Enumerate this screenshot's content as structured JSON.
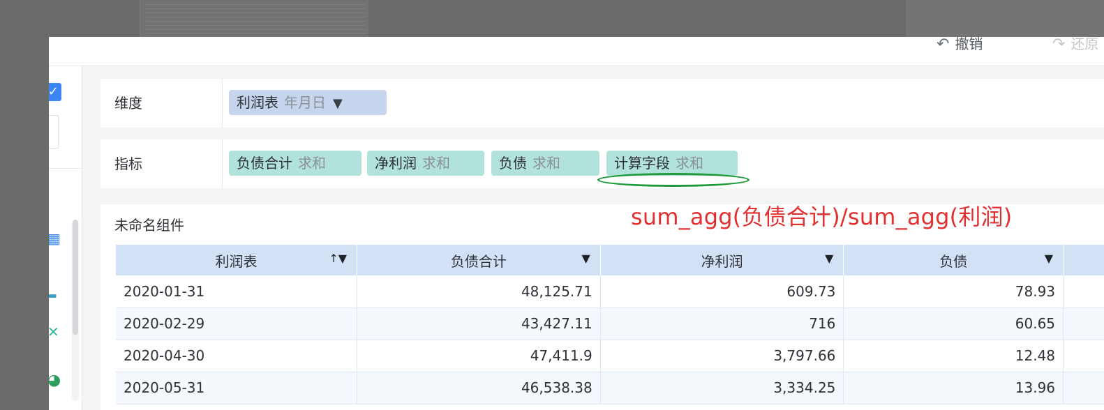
{
  "toolbar": {
    "undo_label": "撤销",
    "redo_label": "还原"
  },
  "dimension": {
    "label": "维度",
    "pills": [
      {
        "field": "利润表",
        "sub": "年月日"
      }
    ]
  },
  "metric": {
    "label": "指标",
    "pills": [
      {
        "field": "负债合计",
        "agg": "求和"
      },
      {
        "field": "净利润",
        "agg": "求和"
      },
      {
        "field": "负债",
        "agg": "求和"
      },
      {
        "field": "计算字段",
        "agg": "求和"
      }
    ]
  },
  "annotation": {
    "formula": "sum_agg(负债合计)/sum_agg(利润)",
    "highlight_color": "#1f9a3a",
    "text_color": "#e23030"
  },
  "component": {
    "title": "未命名组件",
    "columns": [
      {
        "label": "利润表",
        "icon": "sort-filter-icon"
      },
      {
        "label": "负债合计",
        "icon": "dropdown-icon"
      },
      {
        "label": "净利润",
        "icon": "dropdown-icon"
      },
      {
        "label": "负债",
        "icon": "dropdown-icon"
      }
    ],
    "rows": [
      [
        "2020-01-31",
        "48,125.71",
        "609.73",
        "78.93"
      ],
      [
        "2020-02-29",
        "43,427.11",
        "716",
        "60.65"
      ],
      [
        "2020-04-30",
        "47,411.9",
        "3,797.66",
        "12.48"
      ],
      [
        "2020-05-31",
        "46,538.38",
        "3,334.25",
        "13.96"
      ]
    ]
  },
  "colors": {
    "dimension_pill": "#c6d4ee",
    "metric_pill": "#b2e2dc",
    "header_bg": "#d3e1f7",
    "checkbox": "#3a86f5"
  }
}
